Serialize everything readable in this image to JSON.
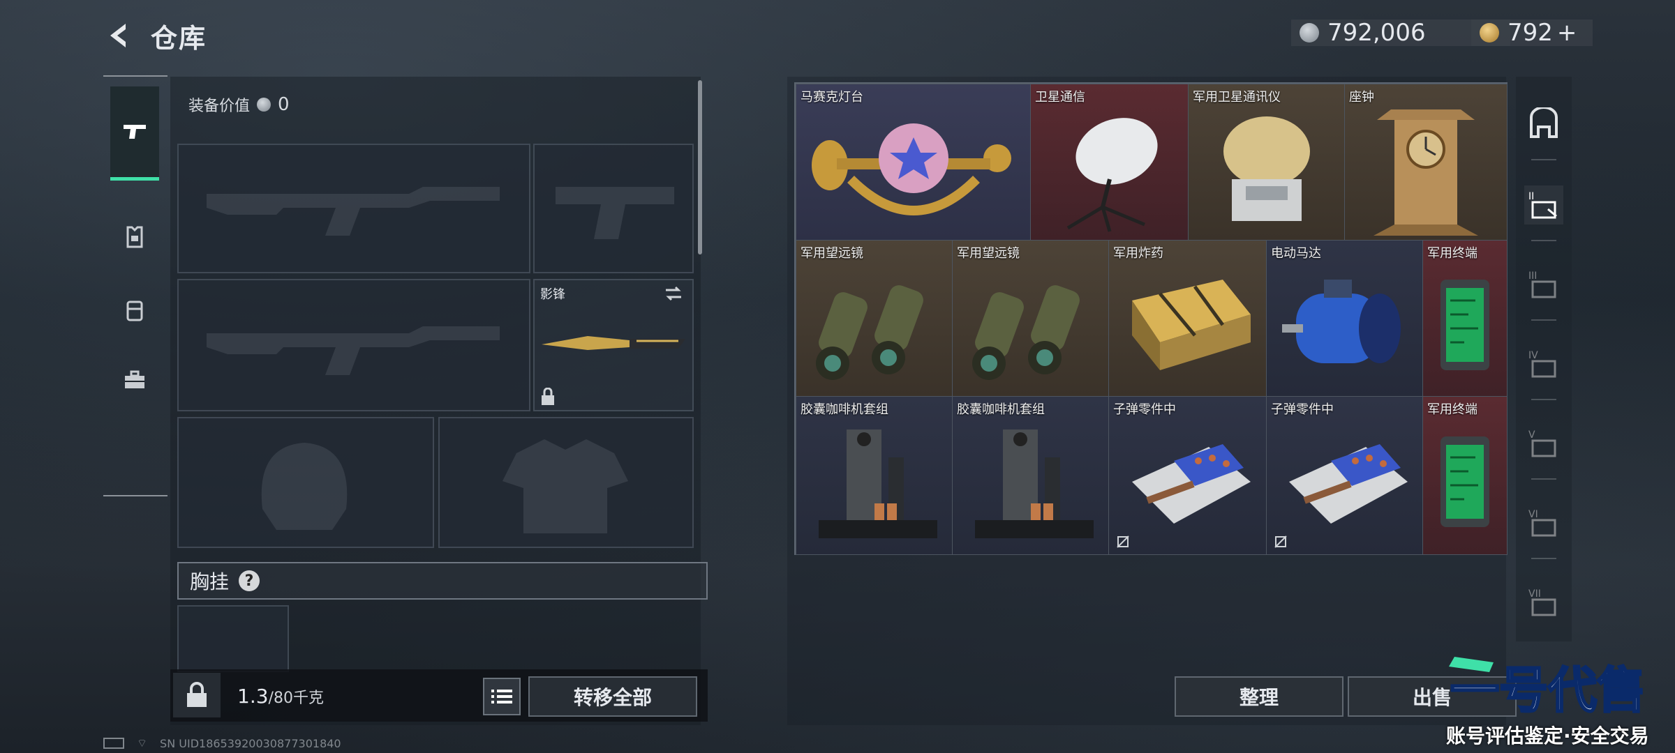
{
  "header": {
    "title": "仓库"
  },
  "currency": {
    "silver": "792,006",
    "gold": "792",
    "gold_add": "+"
  },
  "loadout": {
    "equip_value_label": "装备价值",
    "equip_value": "0",
    "melee_name": "影锋",
    "chest_label": "胸挂",
    "chest_help": "?",
    "weight_value": "1.3",
    "weight_max": "/80千克",
    "transfer_all": "转移全部"
  },
  "storage": {
    "items": [
      {
        "name": "马赛克灯台",
        "rarity": "purple"
      },
      {
        "name": "卫星通信",
        "rarity": "red"
      },
      {
        "name": "军用卫星通讯仪",
        "rarity": "brown"
      },
      {
        "name": "座钟",
        "rarity": "brown"
      },
      {
        "name": "军用望远镜",
        "rarity": "brown"
      },
      {
        "name": "军用望远镜",
        "rarity": "brown"
      },
      {
        "name": "军用炸药",
        "rarity": "brown"
      },
      {
        "name": "电动马达",
        "rarity": "blue"
      },
      {
        "name": "军用终端",
        "rarity": "red"
      },
      {
        "name": "胶囊咖啡机套组",
        "rarity": "blue"
      },
      {
        "name": "胶囊咖啡机套组",
        "rarity": "blue"
      },
      {
        "name": "子弹零件中",
        "rarity": "blue"
      },
      {
        "name": "子弹零件中",
        "rarity": "blue"
      },
      {
        "name": "军用终端",
        "rarity": "red"
      }
    ]
  },
  "buttons": {
    "sort": "整理",
    "sell": "出售"
  },
  "watermark": {
    "brand": "一号代售",
    "tagline": "账号评估鉴定·安全交易"
  },
  "statusbar": {
    "text": "SN UID18653920030877301840"
  },
  "right_nav_roman": [
    "II",
    "III",
    "IV",
    "V",
    "VI",
    "VII"
  ],
  "colors": {
    "accent": "#3fe0a8",
    "rarity_red": "#5a2b31",
    "rarity_brown": "#4d4337",
    "rarity_purple": "#3a3d57",
    "rarity_blue": "#2f3446"
  }
}
